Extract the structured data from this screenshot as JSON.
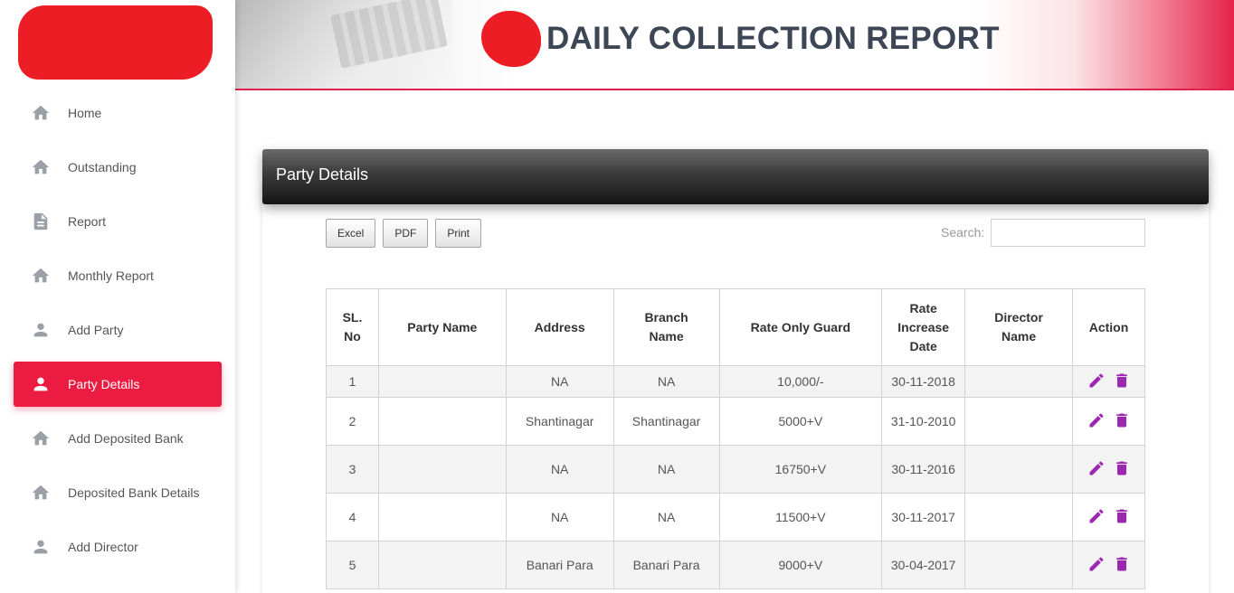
{
  "app": {
    "title": "DAILY COLLECTION REPORT"
  },
  "sidebar": {
    "items": [
      {
        "label": "Home",
        "icon": "home-icon",
        "active": false
      },
      {
        "label": "Outstanding",
        "icon": "home-icon",
        "active": false
      },
      {
        "label": "Report",
        "icon": "document-icon",
        "active": false
      },
      {
        "label": "Monthly Report",
        "icon": "home-icon",
        "active": false
      },
      {
        "label": "Add Party",
        "icon": "person-icon",
        "active": false
      },
      {
        "label": "Party Details",
        "icon": "person-icon",
        "active": true
      },
      {
        "label": "Add Deposited Bank",
        "icon": "home-icon",
        "active": false
      },
      {
        "label": "Deposited Bank Details",
        "icon": "home-icon",
        "active": false
      },
      {
        "label": "Add Director",
        "icon": "person-icon",
        "active": false
      }
    ]
  },
  "panel": {
    "title": "Party Details"
  },
  "toolbar": {
    "excel_label": "Excel",
    "pdf_label": "PDF",
    "print_label": "Print",
    "search_label": "Search:",
    "search_value": ""
  },
  "table": {
    "headers": {
      "sl_no": [
        "SL.",
        "No"
      ],
      "party_name": [
        "Party Name"
      ],
      "address": [
        "Address"
      ],
      "branch_name": [
        "Branch",
        "Name"
      ],
      "rate_only_guard": [
        "Rate Only Guard"
      ],
      "rate_increase_date": [
        "Rate",
        "Increase",
        "Date"
      ],
      "director_name": [
        "Director",
        "Name"
      ],
      "action": [
        "Action"
      ]
    },
    "rows": [
      {
        "sl": "1",
        "party": "",
        "address": "NA",
        "branch": "NA",
        "rate": "10,000/-",
        "date": "30-11-2018",
        "director": ""
      },
      {
        "sl": "2",
        "party": "",
        "address": "Shantinagar",
        "branch": "Shantinagar",
        "rate": "5000+V",
        "date": "31-10-2010",
        "director": ""
      },
      {
        "sl": "3",
        "party": "",
        "address": "NA",
        "branch": "NA",
        "rate": "16750+V",
        "date": "30-11-2016",
        "director": ""
      },
      {
        "sl": "4",
        "party": "",
        "address": "NA",
        "branch": "NA",
        "rate": "11500+V",
        "date": "30-11-2017",
        "director": ""
      },
      {
        "sl": "5",
        "party": "",
        "address": "Banari Para",
        "branch": "Banari Para",
        "rate": "9000+V",
        "date": "30-04-2017",
        "director": ""
      }
    ]
  },
  "colors": {
    "accent": "#ec1b42",
    "action_icons": "#9c27b0",
    "panel_header": "#1f1f1f",
    "redaction": "#e8181f"
  }
}
